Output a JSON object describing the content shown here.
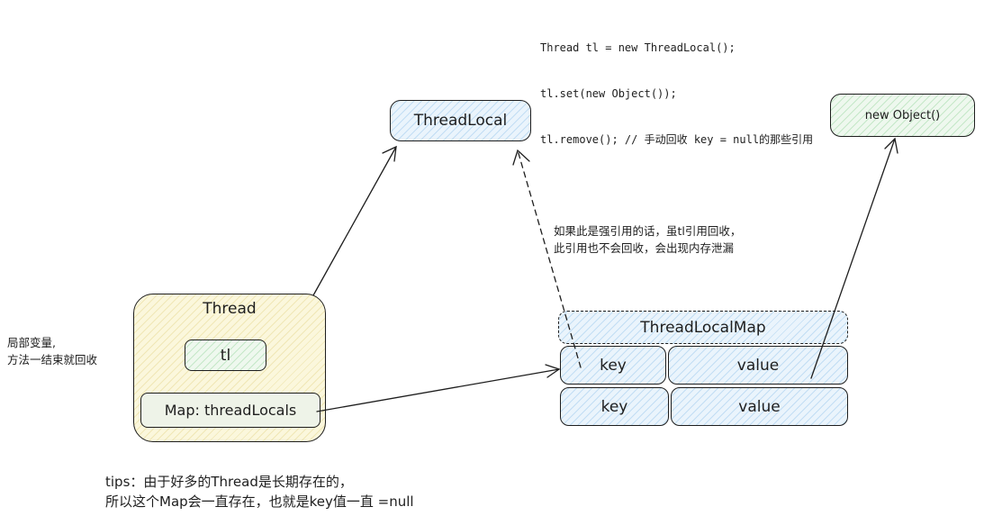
{
  "code_lines": [
    "Thread tl = new ThreadLocal();",
    "tl.set(new Object());",
    "tl.remove(); // 手动回收 key = null的那些引用"
  ],
  "nodes": {
    "thread_local": "ThreadLocal",
    "new_object": "new Object()",
    "thread": "Thread",
    "tl": "tl",
    "map": "Map: threadLocals",
    "thread_local_map": "ThreadLocalMap",
    "rows": [
      {
        "key": "key",
        "value": "value"
      },
      {
        "key": "key",
        "value": "value"
      }
    ]
  },
  "notes": {
    "local_var": [
      "局部变量,",
      "方法一结束就回收"
    ],
    "strong_ref": [
      "如果此是强引用的话，虽tl引用回收，",
      "此引用也不会回收，会出现内存泄漏"
    ]
  },
  "tips": [
    "tips：由于好多的Thread是长期存在的，",
    "所以这个Map会一直存在，也就是key值一直 =null"
  ]
}
